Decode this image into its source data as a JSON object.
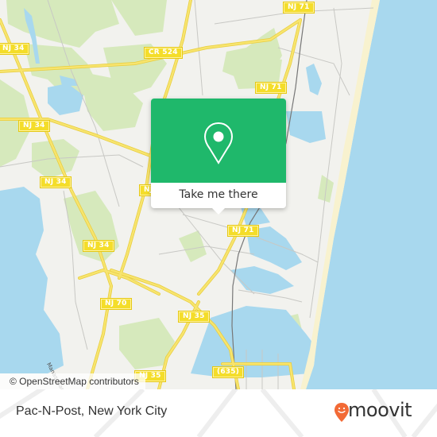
{
  "map": {
    "attribution": "© OpenStreetMap contributors",
    "road_shields": [
      {
        "id": "nj71-top",
        "label": "NJ 71"
      },
      {
        "id": "nj34-a",
        "label": "NJ 34"
      },
      {
        "id": "cr524",
        "label": "CR 524"
      },
      {
        "id": "nj71-mid",
        "label": "NJ 71"
      },
      {
        "id": "nj34-b",
        "label": "NJ 34"
      },
      {
        "id": "nj34-c",
        "label": "NJ 34"
      },
      {
        "id": "nj-partial",
        "label": "NJ"
      },
      {
        "id": "nj71-low",
        "label": "NJ 71"
      },
      {
        "id": "nj34-d",
        "label": "NJ 34"
      },
      {
        "id": "nj70",
        "label": "NJ 70"
      },
      {
        "id": "nj35",
        "label": "NJ 35"
      },
      {
        "id": "cr635",
        "label": "(635)"
      },
      {
        "id": "nj-bottom",
        "label": "NJ 35"
      }
    ],
    "street_label": "Manasquan",
    "colors": {
      "water": "#a8d8ee",
      "land": "#f2f2ee",
      "park": "#d4e8b8",
      "road": "#f7e26b",
      "beach": "#f8f2cf"
    }
  },
  "popup": {
    "icon": "map-pin-icon",
    "button_label": "Take me there",
    "color": "#1fb86b"
  },
  "footer": {
    "place_name": "Pac-N-Post, New York City",
    "brand": "moovit",
    "brand_icon": "moovit-smiley-pin-icon",
    "brand_color": "#f26a36"
  }
}
